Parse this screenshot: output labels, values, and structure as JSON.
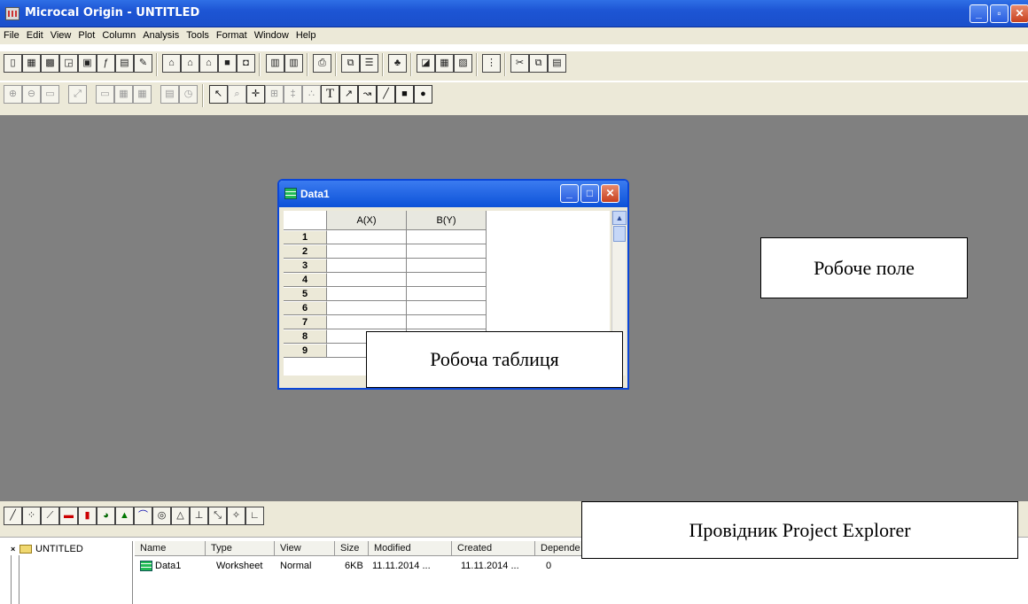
{
  "window": {
    "title": "Microcal Origin - UNTITLED",
    "controls": [
      "_",
      "▫",
      "✕"
    ]
  },
  "menu": [
    "File",
    "Edit",
    "View",
    "Plot",
    "Column",
    "Analysis",
    "Tools",
    "Format",
    "Window",
    "Help"
  ],
  "data_window": {
    "title": "Data1",
    "columns": [
      "A(X)",
      "B(Y)"
    ],
    "rows": [
      "1",
      "2",
      "3",
      "4",
      "5",
      "6",
      "7",
      "8",
      "9"
    ]
  },
  "annotations": {
    "workspace": "Робоче поле",
    "worksheet": "Робоча таблиця",
    "explorer": "Провідник Project Explorer"
  },
  "project_explorer": {
    "tree_root": "UNTITLED",
    "columns": [
      "Name",
      "Type",
      "View",
      "Size",
      "Modified",
      "Created",
      "Depende"
    ],
    "rows": [
      {
        "name": "Data1",
        "type": "Worksheet",
        "view": "Normal",
        "size": "6KB",
        "modified": "11.11.2014 ...",
        "created": "11.11.2014 ...",
        "dependents": "0"
      }
    ]
  },
  "colors": {
    "titlebar": "#1d55d4",
    "workspace": "#808080",
    "chrome": "#ece9d8"
  },
  "icons": {
    "toolbar1": [
      "new-project-icon",
      "new-worksheet-icon",
      "new-excel-icon",
      "new-graph-icon",
      "new-matrix-icon",
      "new-function-icon",
      "new-layout-icon",
      "new-notes-icon",
      "open-icon",
      "open-template-icon",
      "open-excel-icon",
      "save-project-icon",
      "save-template-icon",
      "import-ascii-icon",
      "import-multiple-icon",
      "print-icon",
      "duplicate-icon",
      "refresh-icon",
      "results-log-icon",
      "script-window-icon",
      "code-builder-icon",
      "add-column-icon",
      "cut-icon",
      "copy-icon",
      "paste-icon"
    ],
    "toolbar2": [
      "zoom-in-icon",
      "zoom-out-icon",
      "whole-page-icon",
      "rescale-icon",
      "new-layer-icon",
      "arrange-layers-icon",
      "layer-icon",
      "date-time-icon",
      "pointer-icon",
      "zoom-icon",
      "screen-reader-icon",
      "data-reader-icon",
      "data-selector-icon",
      "draw-data-icon",
      "text-tool-icon",
      "arrow-tool-icon",
      "curved-arrow-icon",
      "line-tool-icon",
      "rectangle-tool-icon",
      "circle-tool-icon"
    ],
    "toolbar3": [
      "line-plot-icon",
      "scatter-plot-icon",
      "line-symbol-icon",
      "bar-chart-icon",
      "column-chart-icon",
      "pie-chart-icon",
      "area-chart-icon",
      "fill-area-icon",
      "polar-icon",
      "ternary-icon",
      "high-low-icon",
      "vector-icon",
      "vector-xyam-icon",
      "axis-icon"
    ]
  }
}
